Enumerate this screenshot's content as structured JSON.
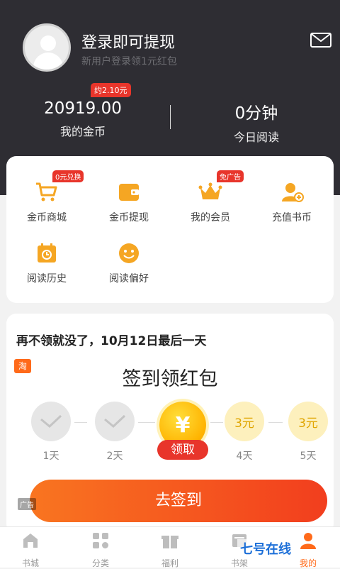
{
  "header": {
    "login_title": "登录即可提现",
    "login_subtitle": "新用户登录领1元红包",
    "coin_badge": "约2.10元",
    "coins_value": "20919.00",
    "coins_label": "我的金币",
    "reading_value": "0分钟",
    "reading_label": "今日阅读",
    "mail_icon": "mail-icon"
  },
  "menu": {
    "items": [
      {
        "label": "金币商城",
        "icon": "cart-icon",
        "badge": "0元兑换"
      },
      {
        "label": "金币提现",
        "icon": "wallet-icon",
        "badge": ""
      },
      {
        "label": "我的会员",
        "icon": "crown-icon",
        "badge": "免广告"
      },
      {
        "label": "充值书币",
        "icon": "user-plus-icon",
        "badge": ""
      },
      {
        "label": "阅读历史",
        "icon": "history-icon",
        "badge": ""
      },
      {
        "label": "阅读偏好",
        "icon": "smile-icon",
        "badge": ""
      }
    ]
  },
  "signin": {
    "notice": "再不领就没了，10月12日最后一天",
    "tag": "淘",
    "title": "签到领红包",
    "days": [
      {
        "label": "1天",
        "state": "done",
        "value": ""
      },
      {
        "label": "2天",
        "state": "done",
        "value": ""
      },
      {
        "label": "3天",
        "state": "today",
        "value": "¥"
      },
      {
        "label": "4天",
        "state": "future",
        "value": "3元"
      },
      {
        "label": "5天",
        "state": "future",
        "value": "3元"
      }
    ],
    "claim_label": "领取",
    "button_label": "去签到",
    "ad_label": "广告"
  },
  "tabbar": {
    "tabs": [
      {
        "label": "书城",
        "icon": "home-icon",
        "active": false
      },
      {
        "label": "分类",
        "icon": "grid-icon",
        "active": false
      },
      {
        "label": "福利",
        "icon": "gift-icon",
        "active": false
      },
      {
        "label": "书架",
        "icon": "bookshelf-icon",
        "active": false
      },
      {
        "label": "我的",
        "icon": "profile-icon",
        "active": true
      }
    ]
  },
  "watermark": "七号在线",
  "colors": {
    "header_bg": "#2e2d33",
    "accent": "#f23e1e",
    "gold": "#ffb300",
    "badge_red": "#e8352b"
  }
}
